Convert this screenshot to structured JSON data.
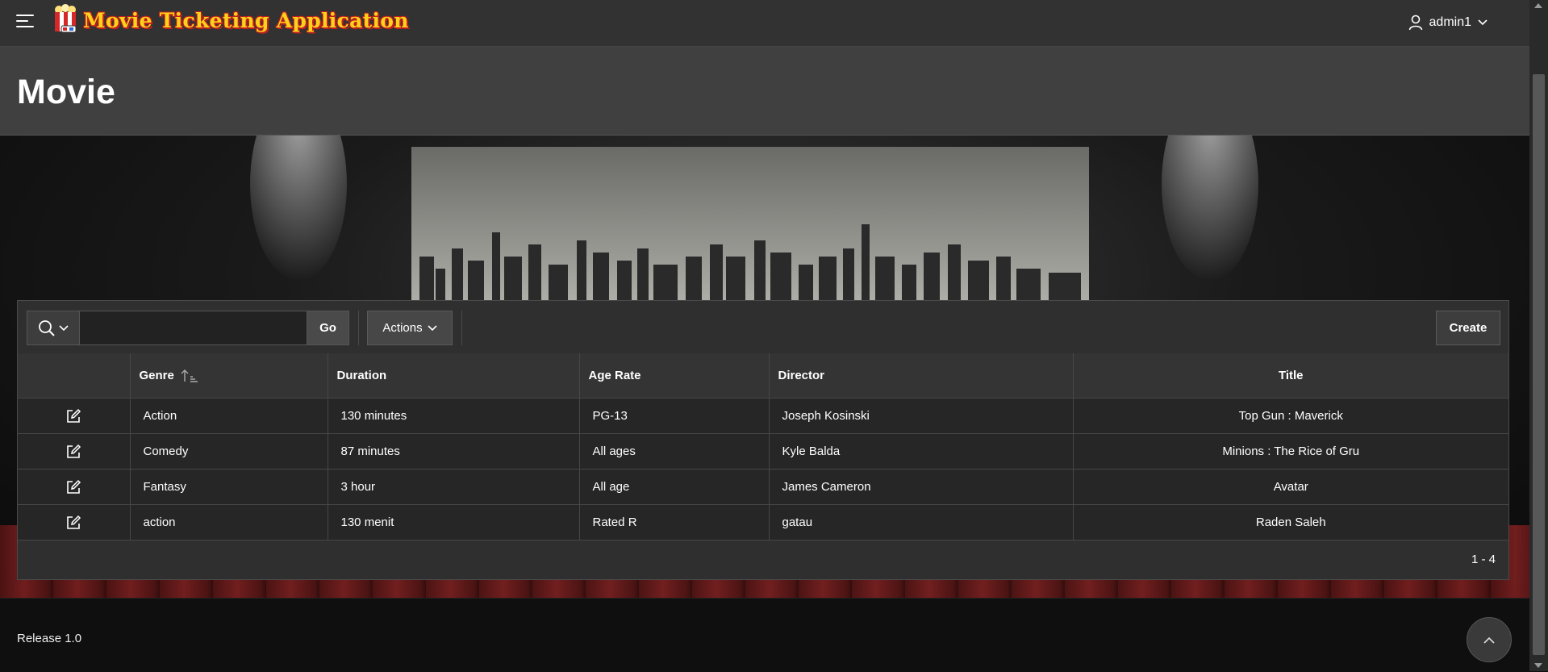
{
  "app": {
    "title": "Movie Ticketing Application",
    "user": "admin1"
  },
  "page": {
    "title": "Movie"
  },
  "toolbar": {
    "search_value": "",
    "go_label": "Go",
    "actions_label": "Actions",
    "create_label": "Create"
  },
  "table": {
    "columns": [
      "",
      "Genre",
      "Duration",
      "Age Rate",
      "Director",
      "Title"
    ],
    "sorted_column": "Genre",
    "sort_direction": "ascending",
    "rows": [
      {
        "genre": "Action",
        "duration": "130 minutes",
        "age_rate": "PG-13",
        "director": "Joseph Kosinski",
        "title": "Top Gun : Maverick"
      },
      {
        "genre": "Comedy",
        "duration": "87 minutes",
        "age_rate": "All ages",
        "director": "Kyle Balda",
        "title": "Minions : The Rice of Gru"
      },
      {
        "genre": "Fantasy",
        "duration": "3 hour",
        "age_rate": "All age",
        "director": "James Cameron",
        "title": "Avatar"
      },
      {
        "genre": "action",
        "duration": "130 menit",
        "age_rate": "Rated R",
        "director": "gatau",
        "title": "Raden Saleh"
      }
    ],
    "pagination": "1 - 4"
  },
  "footer": {
    "release": "Release 1.0"
  },
  "icons": {
    "menu": "hamburger-icon",
    "logo": "popcorn-icon",
    "user": "user-icon",
    "search": "search-icon",
    "edit": "edit-icon",
    "sort": "sort-ascending-icon",
    "back_to_top": "chevron-up-icon"
  },
  "colors": {
    "title_text": "#ffd21a",
    "title_outline": "#c0201f",
    "topbar": "#323232",
    "page_header": "#404040",
    "table_row": "#262626"
  }
}
